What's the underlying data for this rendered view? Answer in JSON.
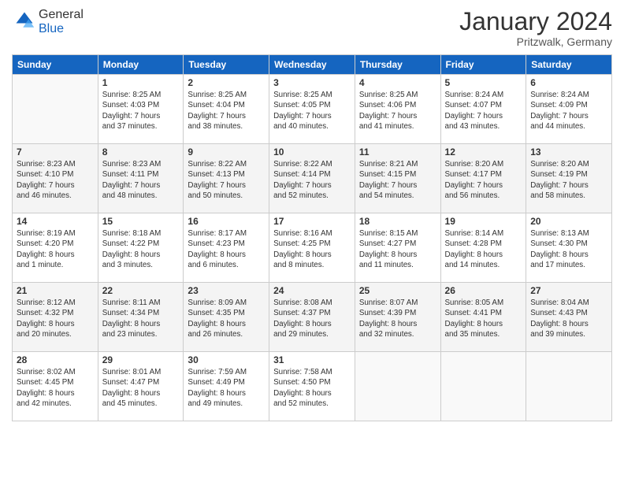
{
  "logo": {
    "general": "General",
    "blue": "Blue"
  },
  "header": {
    "month": "January 2024",
    "location": "Pritzwalk, Germany"
  },
  "days": [
    "Sunday",
    "Monday",
    "Tuesday",
    "Wednesday",
    "Thursday",
    "Friday",
    "Saturday"
  ],
  "weeks": [
    [
      {
        "day": "",
        "content": ""
      },
      {
        "day": "1",
        "content": "Sunrise: 8:25 AM\nSunset: 4:03 PM\nDaylight: 7 hours\nand 37 minutes."
      },
      {
        "day": "2",
        "content": "Sunrise: 8:25 AM\nSunset: 4:04 PM\nDaylight: 7 hours\nand 38 minutes."
      },
      {
        "day": "3",
        "content": "Sunrise: 8:25 AM\nSunset: 4:05 PM\nDaylight: 7 hours\nand 40 minutes."
      },
      {
        "day": "4",
        "content": "Sunrise: 8:25 AM\nSunset: 4:06 PM\nDaylight: 7 hours\nand 41 minutes."
      },
      {
        "day": "5",
        "content": "Sunrise: 8:24 AM\nSunset: 4:07 PM\nDaylight: 7 hours\nand 43 minutes."
      },
      {
        "day": "6",
        "content": "Sunrise: 8:24 AM\nSunset: 4:09 PM\nDaylight: 7 hours\nand 44 minutes."
      }
    ],
    [
      {
        "day": "7",
        "content": "Sunrise: 8:23 AM\nSunset: 4:10 PM\nDaylight: 7 hours\nand 46 minutes."
      },
      {
        "day": "8",
        "content": "Sunrise: 8:23 AM\nSunset: 4:11 PM\nDaylight: 7 hours\nand 48 minutes."
      },
      {
        "day": "9",
        "content": "Sunrise: 8:22 AM\nSunset: 4:13 PM\nDaylight: 7 hours\nand 50 minutes."
      },
      {
        "day": "10",
        "content": "Sunrise: 8:22 AM\nSunset: 4:14 PM\nDaylight: 7 hours\nand 52 minutes."
      },
      {
        "day": "11",
        "content": "Sunrise: 8:21 AM\nSunset: 4:15 PM\nDaylight: 7 hours\nand 54 minutes."
      },
      {
        "day": "12",
        "content": "Sunrise: 8:20 AM\nSunset: 4:17 PM\nDaylight: 7 hours\nand 56 minutes."
      },
      {
        "day": "13",
        "content": "Sunrise: 8:20 AM\nSunset: 4:19 PM\nDaylight: 7 hours\nand 58 minutes."
      }
    ],
    [
      {
        "day": "14",
        "content": "Sunrise: 8:19 AM\nSunset: 4:20 PM\nDaylight: 8 hours\nand 1 minute."
      },
      {
        "day": "15",
        "content": "Sunrise: 8:18 AM\nSunset: 4:22 PM\nDaylight: 8 hours\nand 3 minutes."
      },
      {
        "day": "16",
        "content": "Sunrise: 8:17 AM\nSunset: 4:23 PM\nDaylight: 8 hours\nand 6 minutes."
      },
      {
        "day": "17",
        "content": "Sunrise: 8:16 AM\nSunset: 4:25 PM\nDaylight: 8 hours\nand 8 minutes."
      },
      {
        "day": "18",
        "content": "Sunrise: 8:15 AM\nSunset: 4:27 PM\nDaylight: 8 hours\nand 11 minutes."
      },
      {
        "day": "19",
        "content": "Sunrise: 8:14 AM\nSunset: 4:28 PM\nDaylight: 8 hours\nand 14 minutes."
      },
      {
        "day": "20",
        "content": "Sunrise: 8:13 AM\nSunset: 4:30 PM\nDaylight: 8 hours\nand 17 minutes."
      }
    ],
    [
      {
        "day": "21",
        "content": "Sunrise: 8:12 AM\nSunset: 4:32 PM\nDaylight: 8 hours\nand 20 minutes."
      },
      {
        "day": "22",
        "content": "Sunrise: 8:11 AM\nSunset: 4:34 PM\nDaylight: 8 hours\nand 23 minutes."
      },
      {
        "day": "23",
        "content": "Sunrise: 8:09 AM\nSunset: 4:35 PM\nDaylight: 8 hours\nand 26 minutes."
      },
      {
        "day": "24",
        "content": "Sunrise: 8:08 AM\nSunset: 4:37 PM\nDaylight: 8 hours\nand 29 minutes."
      },
      {
        "day": "25",
        "content": "Sunrise: 8:07 AM\nSunset: 4:39 PM\nDaylight: 8 hours\nand 32 minutes."
      },
      {
        "day": "26",
        "content": "Sunrise: 8:05 AM\nSunset: 4:41 PM\nDaylight: 8 hours\nand 35 minutes."
      },
      {
        "day": "27",
        "content": "Sunrise: 8:04 AM\nSunset: 4:43 PM\nDaylight: 8 hours\nand 39 minutes."
      }
    ],
    [
      {
        "day": "28",
        "content": "Sunrise: 8:02 AM\nSunset: 4:45 PM\nDaylight: 8 hours\nand 42 minutes."
      },
      {
        "day": "29",
        "content": "Sunrise: 8:01 AM\nSunset: 4:47 PM\nDaylight: 8 hours\nand 45 minutes."
      },
      {
        "day": "30",
        "content": "Sunrise: 7:59 AM\nSunset: 4:49 PM\nDaylight: 8 hours\nand 49 minutes."
      },
      {
        "day": "31",
        "content": "Sunrise: 7:58 AM\nSunset: 4:50 PM\nDaylight: 8 hours\nand 52 minutes."
      },
      {
        "day": "",
        "content": ""
      },
      {
        "day": "",
        "content": ""
      },
      {
        "day": "",
        "content": ""
      }
    ]
  ]
}
